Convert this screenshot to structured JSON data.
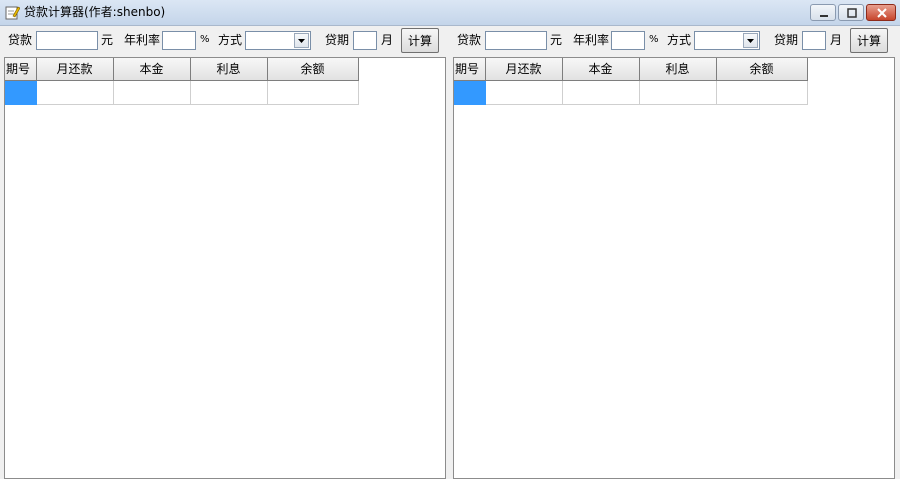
{
  "window": {
    "title": "贷款计算器(作者:shenbo)",
    "controls": [
      "minimize-icon",
      "maximize-icon",
      "close-icon"
    ]
  },
  "colors": {
    "selection": "#3399ff",
    "close_button": "#c7452c"
  },
  "panels": [
    {
      "loan_label": "贷款",
      "loan_value": "",
      "loan_unit": "元",
      "rate_label": "年利率",
      "rate_value": "",
      "rate_unit": "%",
      "method_label": "方式",
      "method_value": "",
      "term_label": "贷期",
      "term_value": "",
      "term_unit": "月",
      "calc_button": "计算",
      "table": {
        "columns": [
          "期号",
          "月还款",
          "本金",
          "利息",
          "余额"
        ],
        "rows": [
          [
            "",
            "",
            "",
            "",
            ""
          ]
        ]
      }
    },
    {
      "loan_label": "贷款",
      "loan_value": "",
      "loan_unit": "元",
      "rate_label": "年利率",
      "rate_value": "",
      "rate_unit": "%",
      "method_label": "方式",
      "method_value": "",
      "term_label": "贷期",
      "term_value": "",
      "term_unit": "月",
      "calc_button": "计算",
      "table": {
        "columns": [
          "期号",
          "月还款",
          "本金",
          "利息",
          "余额"
        ],
        "rows": [
          [
            "",
            "",
            "",
            "",
            ""
          ]
        ]
      }
    }
  ]
}
